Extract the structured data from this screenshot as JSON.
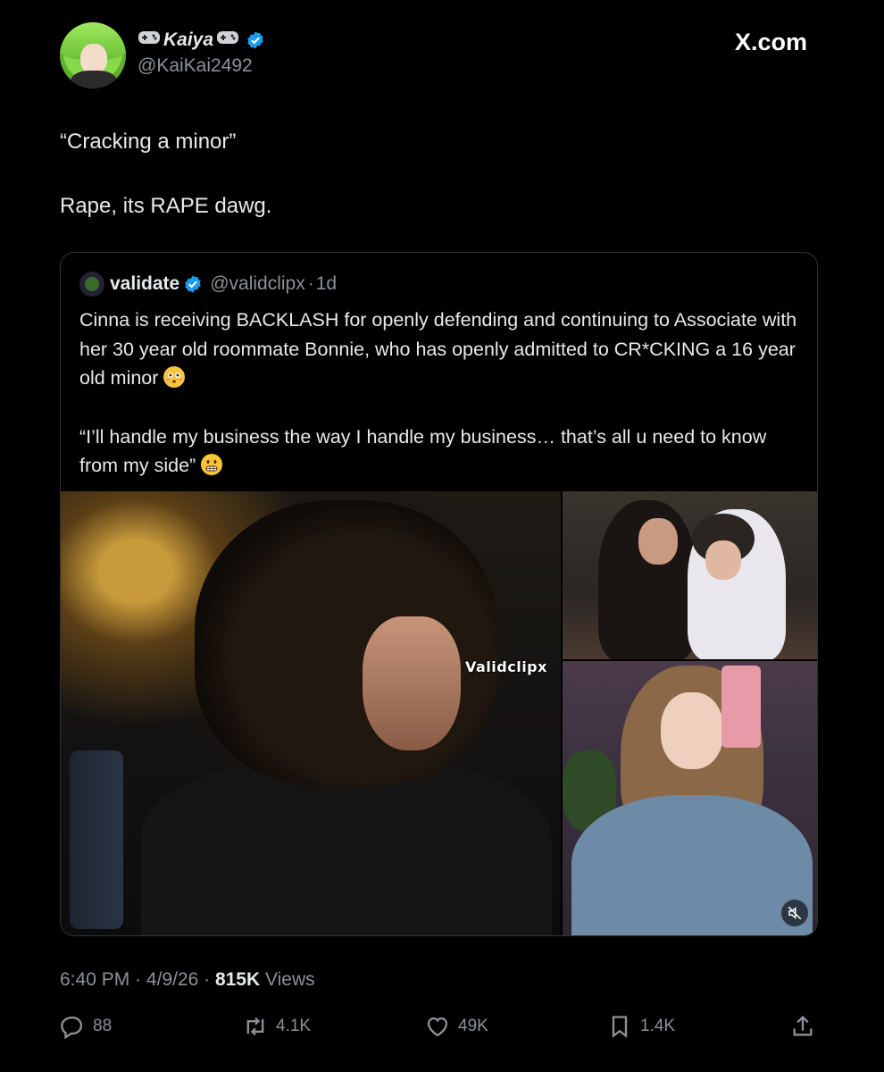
{
  "author": {
    "name": "Kaiya",
    "handle": "@KaiKai2492"
  },
  "site": "X.com",
  "tweet": {
    "line1": "“Cracking a minor”",
    "line2": "Rape, its RAPE dawg."
  },
  "quote": {
    "name": "validate",
    "handle": "@validclipx",
    "age": "1d",
    "para1": "Cinna is receiving BACKLASH for openly defending and continuing to Associate with her 30 year old roommate Bonnie, who has openly admitted to CR*CKING a 16 year old minor",
    "para2": "“I’ll handle my business the way I handle my business…  that’s all u need to know from my side”",
    "watermark": "Validclipx"
  },
  "meta": {
    "time": "6:40 PM",
    "date": "4/9/26",
    "views_count": "815K",
    "views_label": "Views"
  },
  "actions": {
    "replies": "88",
    "reposts": "4.1K",
    "likes": "49K",
    "bookmarks": "1.4K"
  },
  "colors": {
    "background": "#000000",
    "text": "#e7e9ea",
    "muted": "#8b9196",
    "verified": "#1d9bf0"
  },
  "icons": [
    "gamepad-icon",
    "verified-icon",
    "reply-icon",
    "repost-icon",
    "like-icon",
    "bookmark-icon",
    "share-icon",
    "mute-icon"
  ]
}
